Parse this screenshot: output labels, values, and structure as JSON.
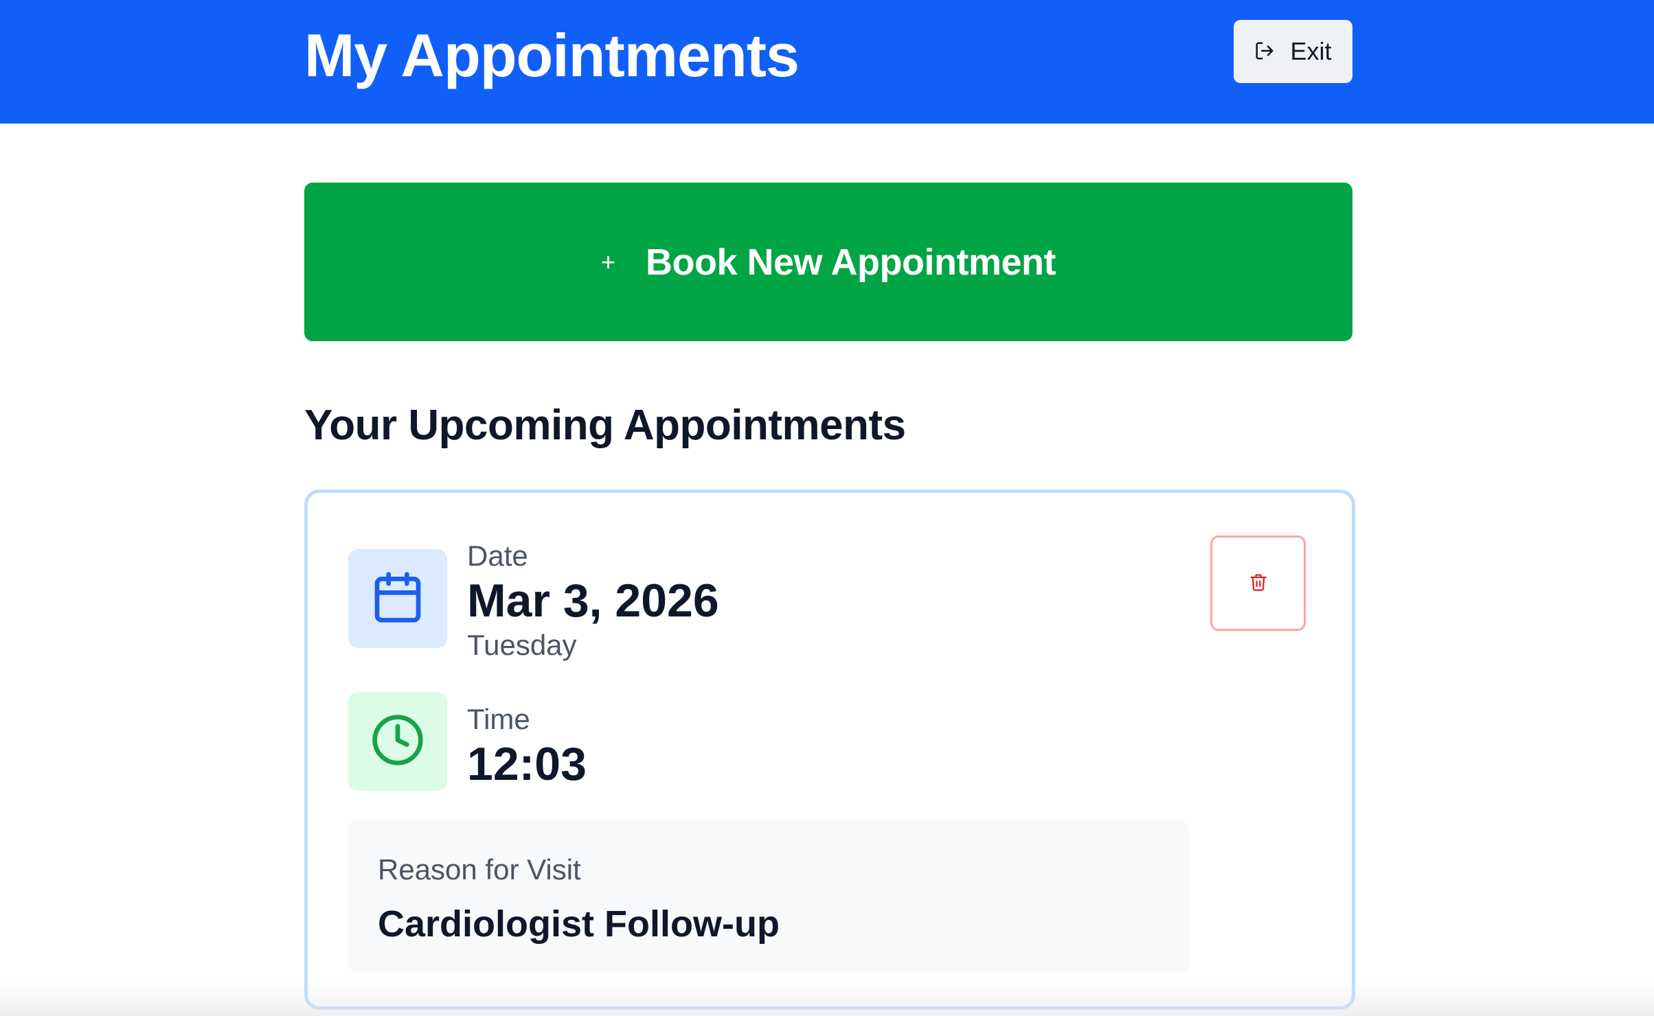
{
  "header": {
    "title": "My Appointments",
    "exit_label": "Exit",
    "exit_icon": "log-out-icon",
    "background_color": "#1060f7"
  },
  "book_button": {
    "label": "Book New Appointment",
    "icon": "+",
    "background_color": "#01a546"
  },
  "section": {
    "title": "Your Upcoming Appointments"
  },
  "appointments": [
    {
      "date_label": "Date",
      "date": "Mar 3, 2026",
      "weekday": "Tuesday",
      "date_icon": "calendar-icon",
      "time_label": "Time",
      "time": "12:03",
      "time_icon": "clock-icon",
      "reason_label": "Reason for Visit",
      "reason": "Cardiologist Follow-up",
      "delete_icon": "trash-icon"
    }
  ],
  "colors": {
    "accent_blue": "#1060f7",
    "accent_green": "#01a546",
    "danger_red": "#dc2626",
    "card_border": "#bfdbfe"
  }
}
